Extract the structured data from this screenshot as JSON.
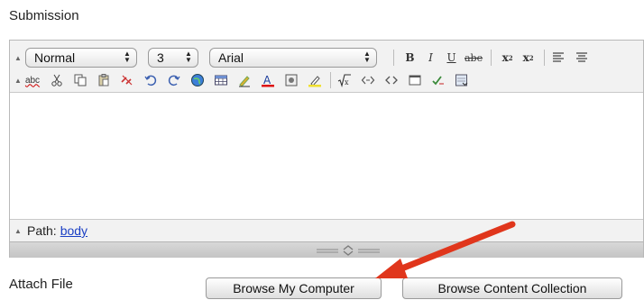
{
  "section": {
    "title": "Submission"
  },
  "toolbar": {
    "style_select": "Normal",
    "size_select": "3",
    "font_select": "Arial",
    "bold": "B",
    "italic": "I",
    "underline": "U",
    "strikethrough": "abe",
    "subscript": "x",
    "subscript_mark": "2",
    "superscript": "x",
    "superscript_mark": "2",
    "spellcheck": "abc"
  },
  "path_bar": {
    "label": "Path:",
    "link": "body"
  },
  "attach": {
    "label": "Attach File",
    "browse_computer": "Browse My Computer",
    "browse_collection": "Browse Content Collection"
  },
  "colors": {
    "arrow": "#e0361c",
    "link": "#1a3fc4",
    "toolbar_bg": "#f2f2f2"
  }
}
